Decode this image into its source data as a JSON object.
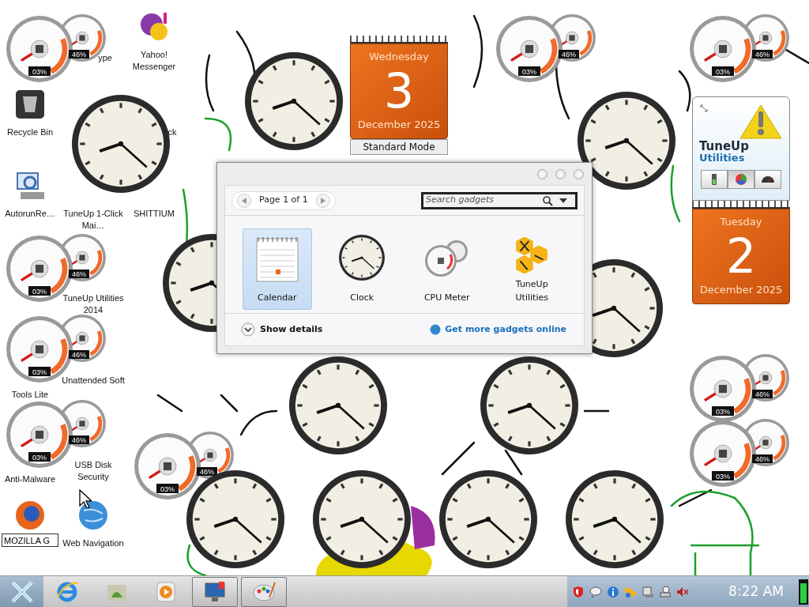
{
  "desktop_icons": [
    {
      "kind": "skype",
      "label": "ype"
    },
    {
      "kind": "messenger",
      "label": "Yahoo! Messenger"
    },
    {
      "kind": "bin",
      "label": "Recycle Bin"
    },
    {
      "kind": "book",
      "label": "ck"
    },
    {
      "kind": "search",
      "label": "AutorunRe…"
    },
    {
      "kind": "tuneup",
      "label": "TuneUp 1-Click Mai…"
    },
    {
      "kind": "globe",
      "label": "SHITTIUM"
    },
    {
      "kind": "tuneup",
      "label": "TuneUp Utilities 2014"
    },
    {
      "kind": "app",
      "label": "Tools Lite"
    },
    {
      "kind": "star",
      "label": "Unattended Soft"
    },
    {
      "kind": "shield",
      "label": "Anti-Malware"
    },
    {
      "kind": "shield",
      "label": "USB Disk Security"
    },
    {
      "kind": "firefox",
      "rename_value": "MOZILLA G"
    },
    {
      "kind": "web",
      "label": "Web Navigation"
    }
  ],
  "cpu_meters": [
    {
      "cpu": "03%",
      "memory": "46%"
    },
    {
      "cpu": "03%",
      "memory": "46%"
    },
    {
      "cpu": "03%",
      "memory": "46%"
    },
    {
      "cpu": "03%",
      "memory": "46%"
    },
    {
      "cpu": "03%",
      "memory": "46%"
    },
    {
      "cpu": "03%",
      "memory": "46%"
    },
    {
      "cpu": "03%",
      "memory": "46%"
    },
    {
      "cpu": "03%",
      "memory": "46%"
    },
    {
      "cpu": "03%",
      "memory": "46%"
    }
  ],
  "calendars": [
    {
      "day_name": "Wednesday",
      "day": "3",
      "month_year": "December 2025",
      "mode_label": "Standard Mode"
    },
    {
      "day_name": "Tuesday",
      "day": "2",
      "month_year": "December 2025"
    }
  ],
  "tuneup_gadget": {
    "title": "TuneUp",
    "subtitle": "Utilities",
    "tabs": [
      {
        "kind": "battery",
        "selected": false
      },
      {
        "kind": "colorwheel",
        "selected": true
      },
      {
        "kind": "gauge",
        "selected": false
      }
    ]
  },
  "gadget_window": {
    "pager": "Page 1 of 1",
    "search": {
      "placeholder": "Search gadgets"
    },
    "gadgets": [
      {
        "kind": "calendar",
        "label": "Calendar",
        "selected": true
      },
      {
        "kind": "clock",
        "label": "Clock",
        "selected": false
      },
      {
        "kind": "meter",
        "label": "CPU Meter",
        "selected": false
      },
      {
        "kind": "tuneup",
        "label": "TuneUp Utilities",
        "selected": false
      }
    ],
    "details_toggle": "Show details",
    "online_link": "Get more gadgets online"
  },
  "taskbar": {
    "pinned": [
      {
        "kind": "browser",
        "active": false
      },
      {
        "kind": "folder",
        "active": false
      },
      {
        "kind": "media",
        "active": false
      },
      {
        "kind": "monitor",
        "active": true
      },
      {
        "kind": "paint",
        "active": true
      }
    ],
    "tray": [
      {
        "kind": "shield"
      },
      {
        "kind": "chat"
      },
      {
        "kind": "info"
      },
      {
        "kind": "tuneup"
      },
      {
        "kind": "device"
      },
      {
        "kind": "network"
      },
      {
        "kind": "volume"
      }
    ],
    "clock": "8:22 AM"
  }
}
